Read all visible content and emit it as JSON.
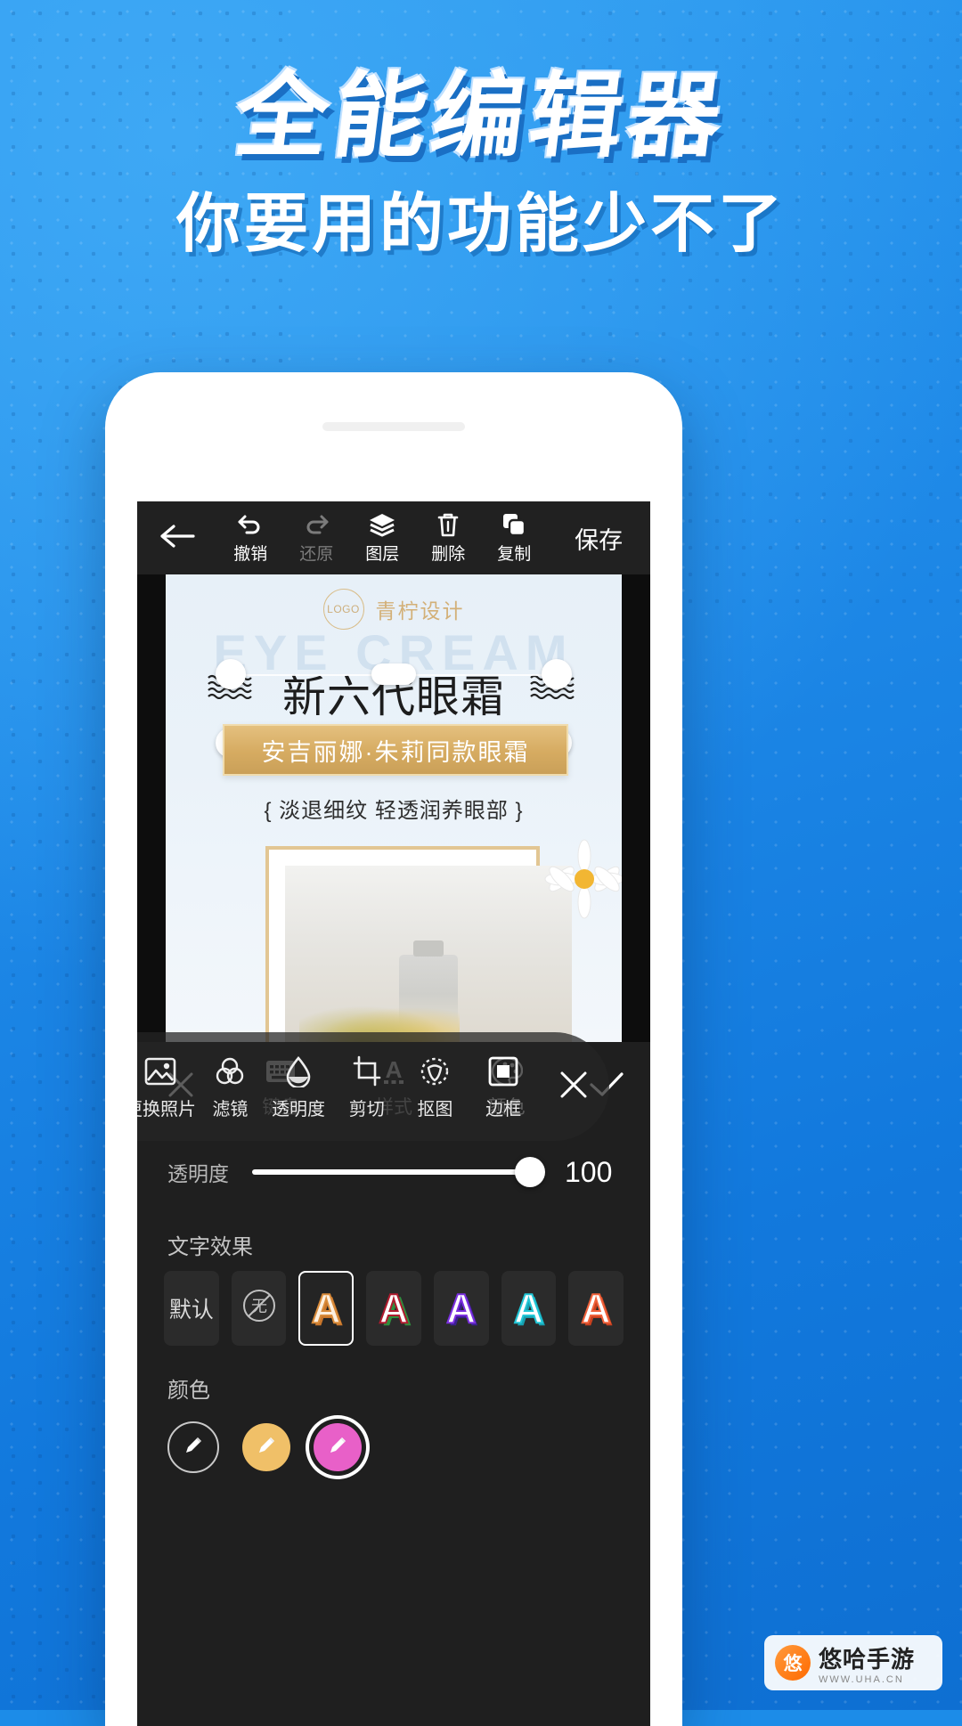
{
  "poster": {
    "headline": "全能编辑器",
    "subhead": "你要用的功能少不了"
  },
  "app": {
    "topbar": {
      "back_icon": "back-arrow-icon",
      "items": [
        {
          "label": "撤销",
          "icon": "undo-icon",
          "enabled": true
        },
        {
          "label": "还原",
          "icon": "redo-icon",
          "enabled": false
        },
        {
          "label": "图层",
          "icon": "layers-icon",
          "enabled": true
        },
        {
          "label": "删除",
          "icon": "trash-icon",
          "enabled": true
        },
        {
          "label": "复制",
          "icon": "copy-icon",
          "enabled": true
        }
      ],
      "save_label": "保存"
    },
    "canvas": {
      "watermark_text": "EYE CREAM",
      "logo_text": "LOGO",
      "brand": "青柠设计",
      "title": "新六代眼霜",
      "banner": "安吉丽娜·朱莉同款眼霜",
      "note": "{ 淡退细纹 轻透润养眼部 }"
    },
    "float_toolbar": {
      "items": [
        {
          "label": "更换照片",
          "icon": "image-icon"
        },
        {
          "label": "滤镜",
          "icon": "filter-circles-icon"
        },
        {
          "label": "透明度",
          "icon": "droplet-icon"
        },
        {
          "label": "剪切",
          "icon": "crop-icon"
        },
        {
          "label": "抠图",
          "icon": "cutout-icon"
        },
        {
          "label": "边框",
          "icon": "frame-icon"
        }
      ],
      "close_icon": "close-icon"
    },
    "panel": {
      "close_icon": "close-icon",
      "confirm_icon": "check-icon",
      "tabs": [
        {
          "label": "键盘",
          "icon": "keyboard-icon",
          "active": false
        },
        {
          "label": "样式",
          "icon": "text-style-icon",
          "active": false
        },
        {
          "label": "颜色",
          "icon": "palette-icon",
          "active": true
        }
      ],
      "opacity": {
        "label": "透明度",
        "value": "100",
        "percent": 100
      },
      "effects": {
        "title": "文字效果",
        "items": [
          {
            "label": "默认",
            "kind": "text"
          },
          {
            "label": "无",
            "kind": "none-circle"
          },
          {
            "label": "A",
            "kind": "glyph",
            "fill": "#fdf0e0",
            "outline": "#d98b3a",
            "selected": true
          },
          {
            "label": "A",
            "kind": "glyph",
            "fill": "#ffffff",
            "outline": "#2f8f3e",
            "selected": false
          },
          {
            "label": "A",
            "kind": "glyph",
            "fill": "#ffffff",
            "outline": "#7b2fe0",
            "selected": false
          },
          {
            "label": "A",
            "kind": "glyph",
            "fill": "#ffffff",
            "outline": "#21c6d6",
            "selected": false
          },
          {
            "label": "A",
            "kind": "glyph",
            "fill": "#ffffff",
            "outline": "#f0613a",
            "selected": false
          }
        ]
      },
      "colors": {
        "title": "颜色",
        "swatches": [
          {
            "hex": "transparent",
            "outline": true,
            "selected": false
          },
          {
            "hex": "#f0c068",
            "outline": false,
            "selected": false
          },
          {
            "hex": "#e860c8",
            "outline": false,
            "selected": true
          }
        ]
      }
    }
  },
  "watermark": {
    "icon_char": "悠",
    "name": "悠哈手游",
    "sub": "WWW.UHA.CN"
  }
}
